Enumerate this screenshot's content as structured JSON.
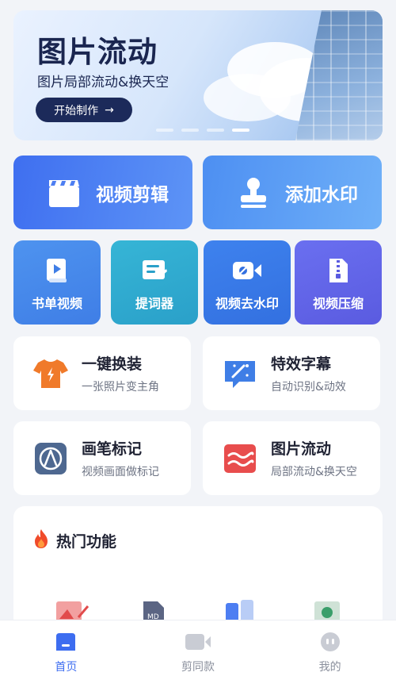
{
  "banner": {
    "title": "图片流动",
    "subtitle": "图片局部流动&换天空",
    "button_label": "开始制作",
    "button_arrow": "→"
  },
  "big_cards": {
    "video_edit": "视频剪辑",
    "add_watermark": "添加水印"
  },
  "small_cards": {
    "book_video": "书单视频",
    "teleprompter": "提词器",
    "remove_watermark": "视频去水印",
    "compress": "视频压缩"
  },
  "features": {
    "outfit": {
      "title": "一键换装",
      "desc": "一张照片变主角"
    },
    "subtitles": {
      "title": "特效字幕",
      "desc": "自动识别&动效"
    },
    "brush": {
      "title": "画笔标记",
      "desc": "视频画面做标记"
    },
    "flow": {
      "title": "图片流动",
      "desc": "局部流动&换天空"
    }
  },
  "hot": {
    "title": "热门功能"
  },
  "tabs": {
    "home": "首页",
    "same": "剪同款",
    "mine": "我的"
  },
  "colors": {
    "accent": "#3d6df0",
    "banner_dark": "#1c2a5a"
  }
}
